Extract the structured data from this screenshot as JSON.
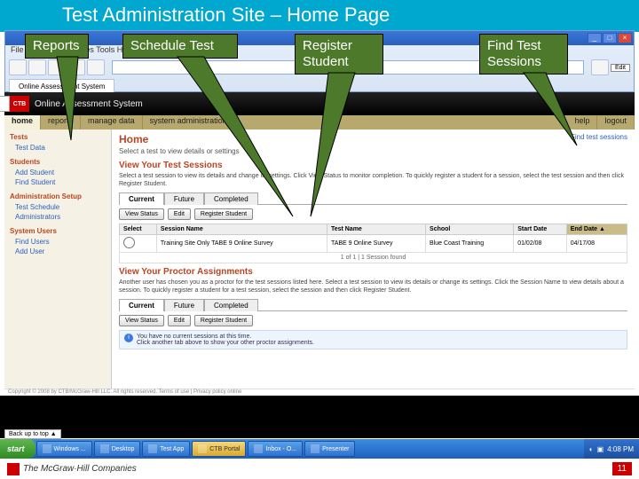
{
  "slide": {
    "title": "Test Administration Site – Home Page",
    "number": "11"
  },
  "callouts": {
    "reports": "Reports",
    "schedule": "Schedule Test",
    "register": "Register\nStudent",
    "find": "Find Test\nSessions"
  },
  "browser": {
    "menu": "File   Edit   View   Favorites   Tools   Help",
    "tab_label": "Online Assessment System"
  },
  "brand": {
    "text": "Online Assessment System",
    "logo": "CTB"
  },
  "primary_tabs": {
    "items": [
      "home",
      "reports",
      "manage data",
      "system administration"
    ],
    "right": [
      "help",
      "logout"
    ]
  },
  "sidebar": {
    "groups": [
      {
        "title": "Tests",
        "items": [
          "Test Data"
        ]
      },
      {
        "title": "Students",
        "items": [
          "Add Student",
          "Find Student"
        ]
      },
      {
        "title": "Administration Setup",
        "items": [
          "Test Schedule",
          "Administrators"
        ]
      },
      {
        "title": "System Users",
        "items": [
          "Find Users",
          "Add User"
        ]
      }
    ]
  },
  "main": {
    "heading": "Home",
    "subhead": "Select a test to view details or settings",
    "top_link": "Find test sessions",
    "sections": {
      "sessions": {
        "title": "View Your Test Sessions",
        "blurb": "Select a test session to view its details and change its settings. Click View Status to monitor completion. To quickly register a student for a session, select the test session and then click Register Student.",
        "tabs": [
          "Current",
          "Future",
          "Completed"
        ],
        "buttons": [
          "View Status",
          "Edit",
          "Register Student"
        ],
        "columns": [
          "Select",
          "Session Name",
          "Test Name",
          "School",
          "Start Date",
          "End Date ▲"
        ],
        "row": {
          "session": "Training Site Only TABE 9 Online Survey",
          "test": "TABE 9 Online Survey",
          "school": "Blue Coast Training",
          "start": "01/02/08",
          "end": "04/17/08"
        },
        "pager": "1 of 1 | 1 Session found"
      },
      "proctor": {
        "title": "View Your Proctor Assignments",
        "blurb": "Another user has chosen you as a proctor for the test sessions listed here. Select a test session to view its details or change its settings. Click the Session Name to view details about a session. To quickly register a student for a test session, select the session and then click Register Student.",
        "tabs": [
          "Current",
          "Future",
          "Completed"
        ],
        "buttons": [
          "View Status",
          "Edit",
          "Register Student"
        ],
        "info": {
          "line1": "You have no current sessions at this time.",
          "line2": "Click another tab above to show your other proctor assignments."
        }
      }
    }
  },
  "copyright": "Copyright © 2008 by CTB/McGraw-Hill LLC. All rights reserved.   Terms of use | Privacy policy online",
  "share_btn": "Back up to top ▲",
  "taskbar": {
    "start": "start",
    "items": [
      "Windows ...",
      "Desktop",
      "Test App",
      "CTB Portal",
      "Inbox - O...",
      "Presenter"
    ],
    "time": "4:08 PM"
  },
  "tray_edit": "Edit",
  "footer_brand": "The McGraw·Hill Companies"
}
